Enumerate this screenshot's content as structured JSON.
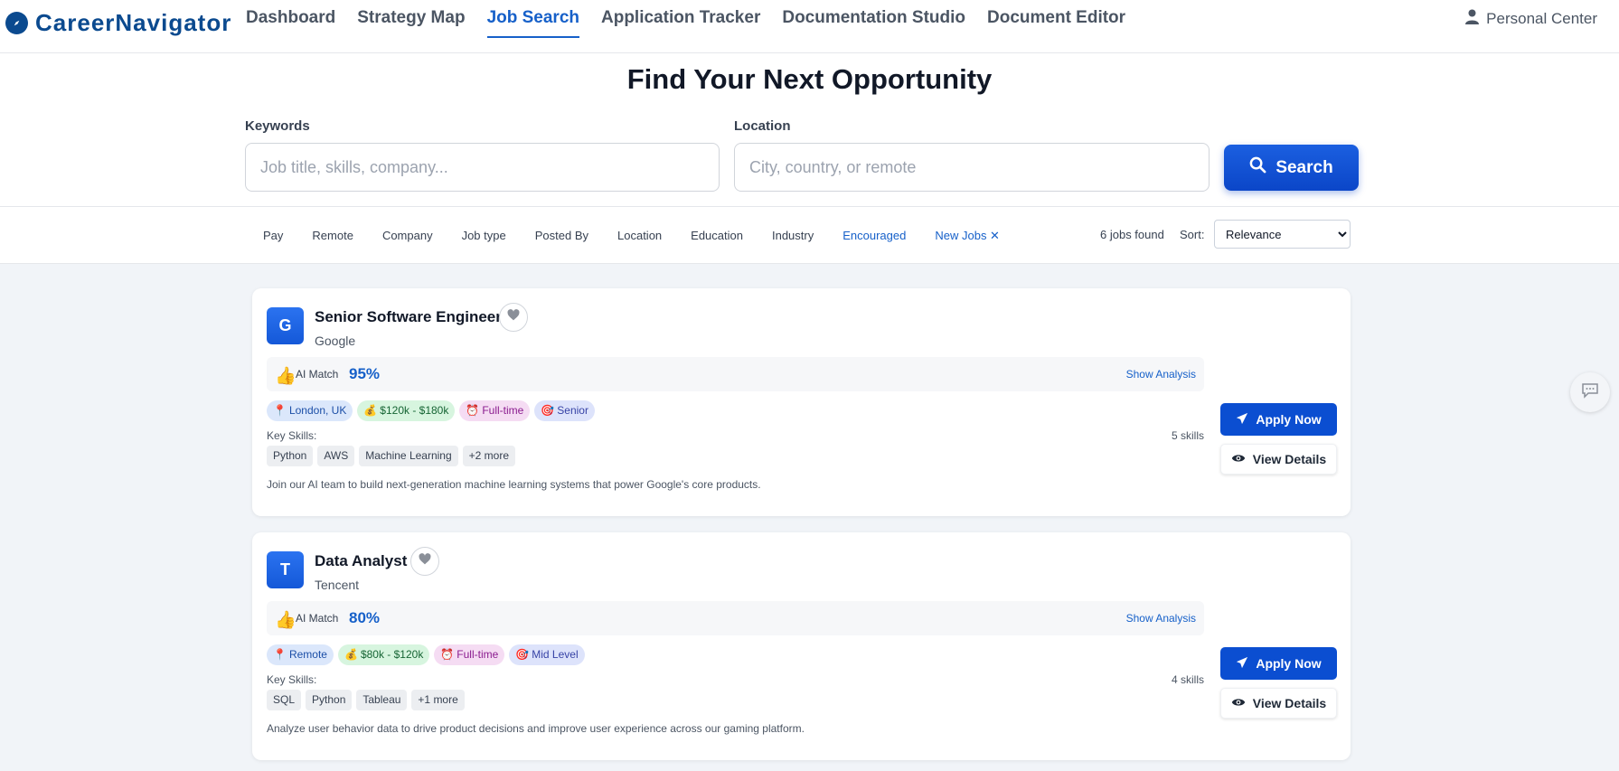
{
  "brand": {
    "name": "CareerNavigator",
    "icon": "compass-icon",
    "color": "#0b4a8f"
  },
  "nav": {
    "links": [
      {
        "label": "Dashboard",
        "active": false
      },
      {
        "label": "Strategy Map",
        "active": false
      },
      {
        "label": "Job Search",
        "active": true
      },
      {
        "label": "Application Tracker",
        "active": false
      },
      {
        "label": "Documentation Studio",
        "active": false
      },
      {
        "label": "Document Editor",
        "active": false
      }
    ],
    "personal_center": "Personal Center"
  },
  "search": {
    "title": "Find Your Next Opportunity",
    "keywords_label": "Keywords",
    "keywords_placeholder": "Job title, skills, company...",
    "location_label": "Location",
    "location_placeholder": "City, country, or remote",
    "button_label": "Search"
  },
  "filters": {
    "items": [
      "Pay",
      "Remote",
      "Company",
      "Job type",
      "Posted By",
      "Location",
      "Education",
      "Industry",
      "Encouraged",
      "New Jobs ✕"
    ],
    "jobs_found": "6 jobs found",
    "sort_label": "Sort:",
    "sort_value": "Relevance"
  },
  "jobs": [
    {
      "logo": "G",
      "title": "Senior Software Engineer",
      "company": "Google",
      "ai_label": "AI Match",
      "ai_score": "95%",
      "show_analysis": "Show Analysis",
      "tags": {
        "location": "London, UK",
        "pay": "$120k - $180k",
        "type": "Full-time",
        "level": "Senior"
      },
      "key_skills_label": "Key Skills:",
      "skill_count": "5 skills",
      "skills": [
        "Python",
        "AWS",
        "Machine Learning",
        "+2 more"
      ],
      "description": "Join our AI team to build next-generation machine learning systems that power Google's core products.",
      "apply_label": "Apply Now",
      "view_label": "View Details"
    },
    {
      "logo": "T",
      "title": "Data Analyst",
      "company": "Tencent",
      "ai_label": "AI Match",
      "ai_score": "80%",
      "show_analysis": "Show Analysis",
      "tags": {
        "location": "Remote",
        "pay": "$80k - $120k",
        "type": "Full-time",
        "level": "Mid Level"
      },
      "key_skills_label": "Key Skills:",
      "skill_count": "4 skills",
      "skills": [
        "SQL",
        "Python",
        "Tableau",
        "+1 more"
      ],
      "description": "Analyze user behavior data to drive product decisions and improve user experience across our gaming platform.",
      "apply_label": "Apply Now",
      "view_label": "View Details"
    }
  ],
  "accent_color": "#1660c9"
}
